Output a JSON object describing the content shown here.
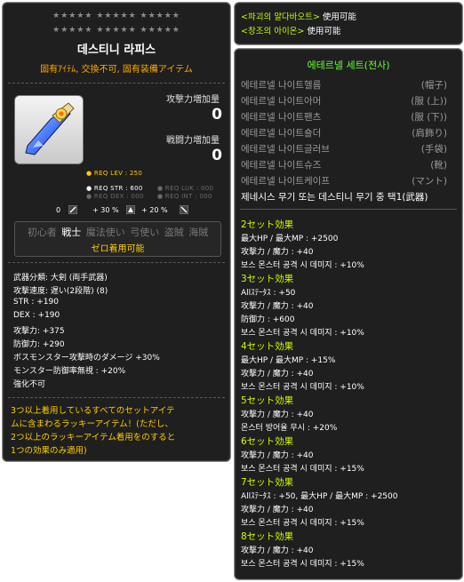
{
  "item": {
    "stars_row1": "★★★★★  ★★★★★  ★★★★★",
    "stars_row2": "★★★★★  ★★★★★  ★★★★★",
    "name": "데스티니 라피스",
    "description": "固有ｱｲﾃﾑ, 交換不可, 固有装備アイテム",
    "attack_increase_label": "攻撃力増加量",
    "attack_increase_value": "0",
    "battle_increase_label": "戦闘力増加量",
    "battle_increase_value": "0",
    "req": {
      "lev": "● REQ LEV : 250",
      "str": "● REQ STR : 600",
      "luk": "● REQ LUK : 000",
      "dex": "● REQ DEX : 000",
      "int": "● REQ INT : 000"
    },
    "small_stats": {
      "s1": "0",
      "s2": "+ 30 %",
      "s3": "+ 20 %"
    },
    "jobs": {
      "beginner": "初心者",
      "warrior": "戦士",
      "magician": "魔法使い",
      "archer": "弓使い",
      "thief": "盗賊",
      "pirate": "海賊"
    },
    "zero_text": "ゼロ着用可能",
    "stats": [
      "武器分類: 大剣 (両手武器)",
      "攻撃速度: 遅い(2段階) (8)",
      "STR : +190",
      "DEX : +190",
      "攻撃力: +375",
      "防御力: +290",
      "ボスモンスター攻撃時のダメージ +30%",
      "モンスター防御率無視 : +20%",
      "強化不可"
    ],
    "lucky_lines": [
      "3つ以上着用しているすべてのセットアイテ",
      "ムに含まわるラッキーアイテム！(ただし、",
      "2つ以上のラッキーアイテム着用をのすると",
      "1つの効果のみ適用)"
    ]
  },
  "top_right": {
    "line1_name": "<파괴의 얄다바오트>",
    "line1_status": "使用可能",
    "line2_name": "<창조의 아이온>",
    "line2_status": "使用可能"
  },
  "set": {
    "title": "에테르넬 세트(전사)",
    "items": [
      {
        "name": "에테르넬 나이트헬름",
        "part": "(帽子)"
      },
      {
        "name": "에테르넬 나이트아머",
        "part": "(服 (上))"
      },
      {
        "name": "에테르넬 나이트팬츠",
        "part": "(服 (下))"
      },
      {
        "name": "에테르넬 나이트숄더",
        "part": "(肩飾り)"
      },
      {
        "name": "에테르넬 나이트글러브",
        "part": "(手袋)"
      },
      {
        "name": "에테르넬 나이트슈즈",
        "part": "(靴)"
      },
      {
        "name": "에테르넬 나이트케이프",
        "part": "(マント)"
      }
    ],
    "special": "제네시스 무기 또는 데스티니 무기 중 택1(武器)",
    "effects": [
      {
        "head": "2セット効果",
        "lines": [
          "最大HP / 最大MP : +2500",
          "攻撃力 / 魔力 : +40",
          "보스 몬스터 공격 시 데미지 : +10%"
        ]
      },
      {
        "head": "3セット効果",
        "lines": [
          "Allｽﾃｰﾀｽ : +50",
          "攻撃力 / 魔力 : +40",
          "防御力 : +600",
          "보스 몬스터 공격 시 데미지 : +10%"
        ]
      },
      {
        "head": "4セット効果",
        "lines": [
          "最大HP / 最大MP : +15%",
          "攻撃力 / 魔力 : +40",
          "보스 몬스터 공격 시 데미지 : +10%"
        ]
      },
      {
        "head": "5セット効果",
        "lines": [
          "攻撃力 / 魔力 : +40",
          "몬스터 방어율 무시 : +20%"
        ]
      },
      {
        "head": "6セット効果",
        "lines": [
          "攻撃力 / 魔力 : +40",
          "보스 몬스터 공격 시 데미지 : +15%"
        ]
      },
      {
        "head": "7セット効果",
        "lines": [
          "Allｽﾃｰﾀｽ : +50, 最大HP / 最大MP : +2500",
          "攻撃力 / 魔力 : +40",
          "보스 몬스터 공격 시 데미지 : +15%"
        ]
      },
      {
        "head": "8セット効果",
        "lines": [
          "攻撃力 / 魔力 : +40",
          "보스 몬스터 공격 시 데미지 : +15%"
        ]
      }
    ]
  }
}
